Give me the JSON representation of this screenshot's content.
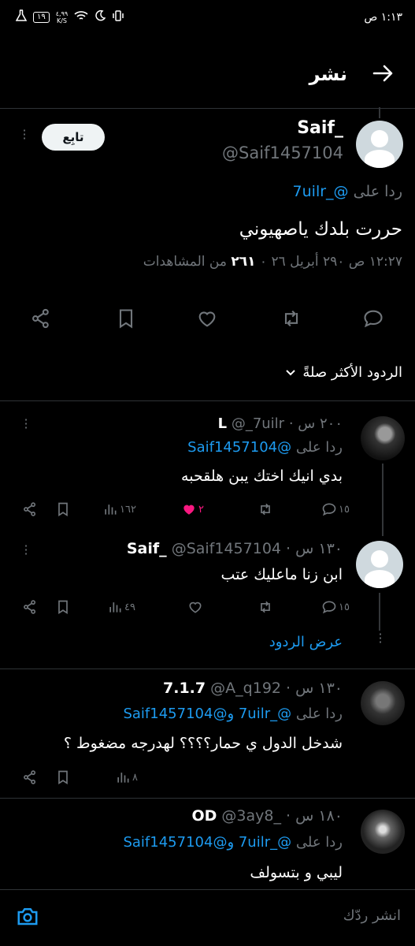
{
  "status_bar": {
    "time": "١:١٣ ص",
    "battery": "١٩",
    "net_speed": "٤,٩٩\nK/S"
  },
  "header": {
    "title": "نشر"
  },
  "main_tweet": {
    "display_name": "Saif_",
    "handle": "@Saif1457104",
    "follow_label": "تابِع",
    "reply_to_prefix": "ردا على",
    "reply_to_handle": "@_7uilr",
    "text": "حررت بلدك ياصهيوني",
    "timestamp": "١٢:٢٧ ص ٢٩٠ أبريل ٢٦ ٠",
    "views_count": "٢٦١",
    "views_label": "من المشاهدات"
  },
  "sort": {
    "label": "الردود الأكثر صلةً"
  },
  "replies": [
    {
      "display_name": "_7uilr",
      "badge": "L",
      "handle": "@_7uilr",
      "time": "٢٠٠ س",
      "reply_to_prefix": "ردا على",
      "reply_to_handle": "@Saif1457104",
      "text": "بدي انيك اختك يبن هلقحبه",
      "replies_count": "١٥",
      "likes_count": "٢",
      "views_count": "١٦٢"
    },
    {
      "display_name": "Saif_",
      "handle": "@Saif1457104",
      "time": "١٣٠ س",
      "text": "ابن زنا ماعليك عتب",
      "replies_count": "١٥",
      "views_count": "٤٩"
    },
    {
      "display_name": "7.1.7",
      "handle": "@A_q192",
      "time": "١٣٠ س",
      "reply_to_prefix": "ردا على",
      "reply_to_handles": "@_7uilr و@Saif1457104",
      "text": "شدخل الدول ي حمار؟؟؟؟ لهدرجه مضغوط ؟",
      "views_count": "٨"
    },
    {
      "display_name": "OD",
      "handle": "@3ay8_",
      "time": "١٨٠ س",
      "reply_to_prefix": "ردا على",
      "reply_to_handles": "@_7uilr و@Saif1457104",
      "text": "ليبي و بتسولف"
    }
  ],
  "show_replies": {
    "label": "عرض الردود"
  },
  "composer": {
    "placeholder": "انشر ردّك"
  },
  "colors": {
    "accent": "#1d9bf0",
    "like_active": "#f91880",
    "background": "#000000"
  }
}
